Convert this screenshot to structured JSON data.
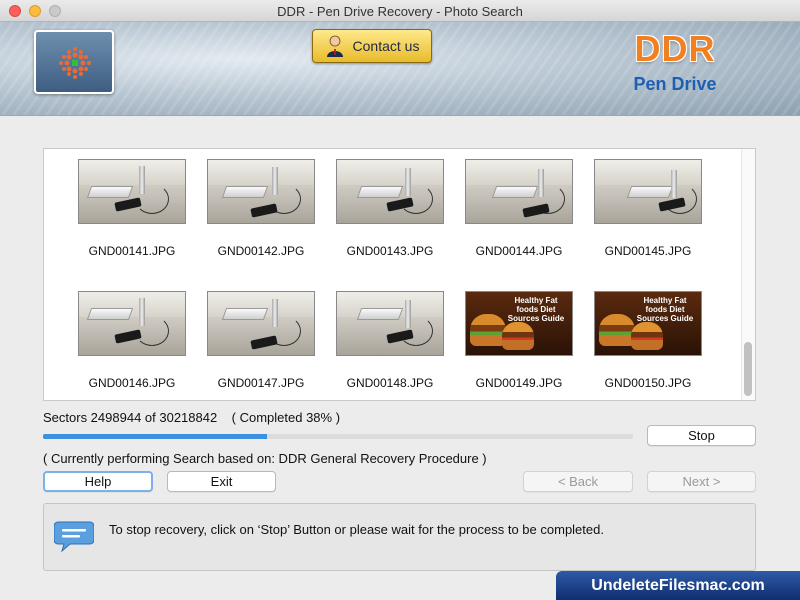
{
  "window": {
    "title": "DDR - Pen Drive Recovery - Photo Search"
  },
  "header": {
    "contact_label": "Contact us",
    "brand_title": "DDR",
    "brand_subtitle": "Pen Drive"
  },
  "photos": [
    {
      "name": "GND00141.JPG",
      "kind": "desk"
    },
    {
      "name": "GND00142.JPG",
      "kind": "desk"
    },
    {
      "name": "GND00143.JPG",
      "kind": "desk"
    },
    {
      "name": "GND00144.JPG",
      "kind": "desk"
    },
    {
      "name": "GND00145.JPG",
      "kind": "desk"
    },
    {
      "name": "GND00146.JPG",
      "kind": "desk"
    },
    {
      "name": "GND00147.JPG",
      "kind": "desk"
    },
    {
      "name": "GND00148.JPG",
      "kind": "desk"
    },
    {
      "name": "GND00149.JPG",
      "kind": "food"
    },
    {
      "name": "GND00150.JPG",
      "kind": "food"
    }
  ],
  "food_caption": "Healthy Fat foods Diet Sources Guide",
  "progress": {
    "sectors_text": "Sectors 2498944 of 30218842    ( Completed 38% )",
    "fraction": 0.38,
    "status_text": "( Currently performing Search based on: DDR General Recovery Procedure )"
  },
  "buttons": {
    "stop": "Stop",
    "help": "Help",
    "exit": "Exit",
    "back": "< Back",
    "next": "Next >"
  },
  "info": {
    "message": "To stop recovery, click on ‘Stop’ Button or please wait for the process to be completed."
  },
  "watermark": "UndeleteFilesmac.com",
  "colors": {
    "progress_fill": "#3d8fe0",
    "brand_orange": "#f08020",
    "brand_blue": "#1c5fb3"
  }
}
